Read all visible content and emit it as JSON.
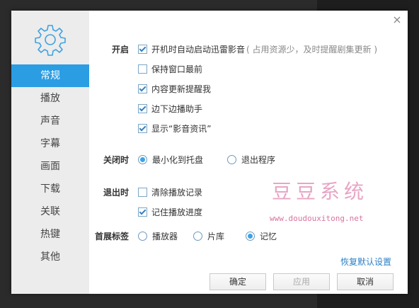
{
  "sidebar": {
    "items": [
      {
        "label": "常规",
        "active": true
      },
      {
        "label": "播放"
      },
      {
        "label": "声音"
      },
      {
        "label": "字幕"
      },
      {
        "label": "画面"
      },
      {
        "label": "下载"
      },
      {
        "label": "关联"
      },
      {
        "label": "热键"
      },
      {
        "label": "其他"
      }
    ]
  },
  "sections": {
    "startup": {
      "label": "开启",
      "options": [
        {
          "label": "开机时自动启动迅雷影音",
          "hint": "( 占用资源少，及时提醒剧集更新 )",
          "checked": true
        },
        {
          "label": "保持窗口最前",
          "checked": false
        },
        {
          "label": "内容更新提醒我",
          "checked": true
        },
        {
          "label": "边下边播助手",
          "checked": true
        },
        {
          "label": "显示“影音资讯”",
          "checked": true
        }
      ]
    },
    "on_close": {
      "label": "关闭时",
      "options": [
        {
          "label": "最小化到托盘",
          "checked": true
        },
        {
          "label": "退出程序",
          "checked": false
        }
      ]
    },
    "on_exit": {
      "label": "退出时",
      "options": [
        {
          "label": "清除播放记录",
          "checked": false
        },
        {
          "label": "记住播放进度",
          "checked": true
        }
      ]
    },
    "first_tab": {
      "label": "首展标签",
      "options": [
        {
          "label": "播放器",
          "checked": false
        },
        {
          "label": "片库",
          "checked": false
        },
        {
          "label": "记忆",
          "checked": true
        }
      ]
    }
  },
  "watermark": {
    "title": "豆豆系统",
    "url": "www.doudouxitong.net"
  },
  "restore_defaults": "恢复默认设置",
  "buttons": {
    "ok": "确定",
    "apply": "应用",
    "cancel": "取消"
  },
  "colors": {
    "accent": "#2b9de3",
    "sidebar_bg": "#ececec",
    "link": "#2b7fc6",
    "watermark": "#e8a5c4"
  },
  "icons": {
    "logo": "gear-icon",
    "close": "close-icon"
  }
}
